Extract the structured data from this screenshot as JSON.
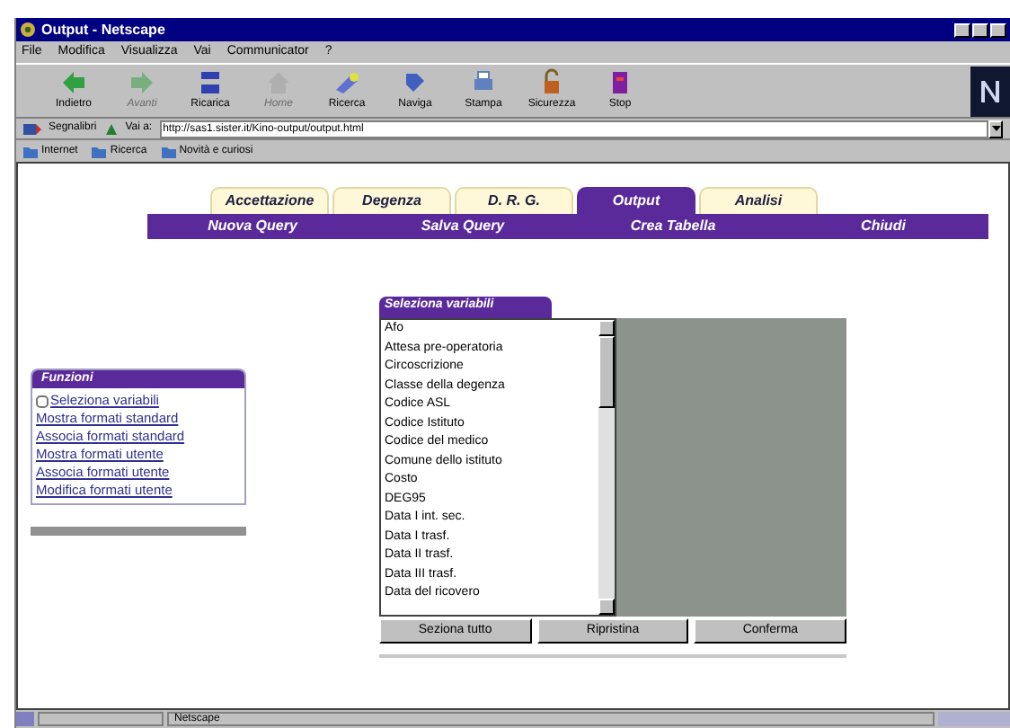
{
  "window": {
    "title": "Output - Netscape"
  },
  "menu": [
    "File",
    "Modifica",
    "Visualizza",
    "Vai",
    "Communicator",
    "?"
  ],
  "toolbar": [
    {
      "label": "Indietro",
      "disabled": false
    },
    {
      "label": "Avanti",
      "disabled": true
    },
    {
      "label": "Ricarica",
      "disabled": false
    },
    {
      "label": "Home",
      "disabled": true
    },
    {
      "label": "Ricerca",
      "disabled": false
    },
    {
      "label": "Naviga",
      "disabled": false
    },
    {
      "label": "Stampa",
      "disabled": false
    },
    {
      "label": "Sicurezza",
      "disabled": false
    },
    {
      "label": "Stop",
      "disabled": false
    }
  ],
  "location": {
    "bookmarks": "Segnalibri",
    "label": "Vai a:",
    "url": "http://sas1.sister.it/Kino-output/output.html"
  },
  "personal_bar": [
    "Internet",
    "Ricerca",
    "Novità e curiosi"
  ],
  "tabs": [
    {
      "label": "Accettazione",
      "selected": false
    },
    {
      "label": "Degenza",
      "selected": false
    },
    {
      "label": "D. R. G.",
      "selected": false
    },
    {
      "label": "Output",
      "selected": true
    },
    {
      "label": "Analisi",
      "selected": false
    }
  ],
  "subnav": [
    "Nuova Query",
    "Salva Query",
    "Crea Tabella",
    "Chiudi"
  ],
  "functions": {
    "title": "Funzioni",
    "items": [
      {
        "kind": "checkbox",
        "label": "Seleziona variabili",
        "checked": false
      },
      {
        "kind": "link",
        "label": "Mostra formati standard"
      },
      {
        "kind": "link",
        "label": "Associa formati standard"
      },
      {
        "kind": "link",
        "label": "Mostra formati utente"
      },
      {
        "kind": "link",
        "label": "Associa formati utente"
      },
      {
        "kind": "link",
        "label": "Modifica formati utente"
      }
    ]
  },
  "variables": {
    "title": "Seleziona variabili",
    "items": [
      "Afo",
      "Attesa pre-operatoria",
      "Circoscrizione",
      "Classe della degenza",
      "Codice ASL",
      "Codice Istituto",
      "Codice del medico",
      "Comune dello istituto",
      "Costo",
      "DEG95",
      "Data I int. sec.",
      "Data I trasf.",
      "Data II trasf.",
      "Data III trasf.",
      "Data del ricovero"
    ],
    "buttons": [
      "Seziona tutto",
      "Ripristina",
      "Conferma"
    ]
  },
  "status_bar": {
    "text": "Netscape"
  }
}
